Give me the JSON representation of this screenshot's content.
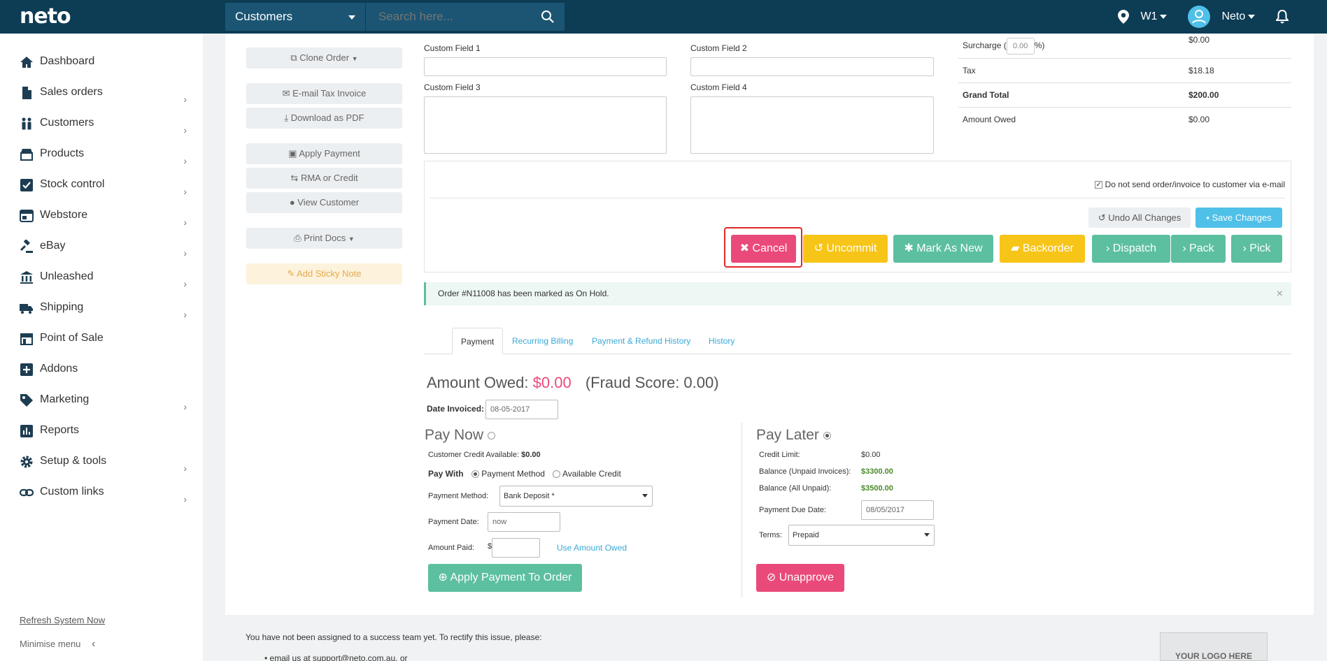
{
  "header": {
    "logo": "neto",
    "search_scope": "Customers",
    "search_placeholder": "Search here...",
    "location": "W1",
    "user": "Neto"
  },
  "sidebar": {
    "items": [
      {
        "label": "Dashboard",
        "icon": "home-icon",
        "has_children": false
      },
      {
        "label": "Sales orders",
        "icon": "document-icon",
        "has_children": true
      },
      {
        "label": "Customers",
        "icon": "people-icon",
        "has_children": true
      },
      {
        "label": "Products",
        "icon": "shop-icon",
        "has_children": true
      },
      {
        "label": "Stock control",
        "icon": "checkbox-icon",
        "has_children": true
      },
      {
        "label": "Webstore",
        "icon": "browser-icon",
        "has_children": true
      },
      {
        "label": "eBay",
        "icon": "gavel-icon",
        "has_children": true
      },
      {
        "label": "Unleashed",
        "icon": "bank-icon",
        "has_children": true
      },
      {
        "label": "Shipping",
        "icon": "truck-icon",
        "has_children": true
      },
      {
        "label": "Point of Sale",
        "icon": "store-icon",
        "has_children": false
      },
      {
        "label": "Addons",
        "icon": "plus-square-icon",
        "has_children": false
      },
      {
        "label": "Marketing",
        "icon": "tag-icon",
        "has_children": true
      },
      {
        "label": "Reports",
        "icon": "chart-icon",
        "has_children": false
      },
      {
        "label": "Setup & tools",
        "icon": "gear-icon",
        "has_children": true
      },
      {
        "label": "Custom links",
        "icon": "link-icon",
        "has_children": true
      }
    ],
    "refresh": "Refresh System Now",
    "minimise": "Minimise menu"
  },
  "left_actions": {
    "clone": "Clone Order",
    "email": "E-mail Tax Invoice",
    "pdf": "Download as PDF",
    "apply_payment": "Apply Payment",
    "rma": "RMA or Credit",
    "view_customer": "View Customer",
    "print": "Print Docs",
    "sticky": "Add Sticky Note"
  },
  "custom_fields": {
    "f1": "Custom Field 1",
    "f2": "Custom Field 2",
    "f3": "Custom Field 3",
    "f4": "Custom Field 4"
  },
  "summary": {
    "surcharge_label": "Surcharge (",
    "surcharge_pct": "0.00",
    "surcharge_suffix": "%)",
    "surcharge_value": "$0.00",
    "tax_label": "Tax",
    "tax_value": "$18.18",
    "grand_label": "Grand Total",
    "grand_value": "$200.00",
    "owed_label": "Amount Owed",
    "owed_value": "$0.00"
  },
  "order_actions": {
    "no_email": "Do not send order/invoice to customer via e-mail",
    "undo": "Undo All Changes",
    "save": "Save Changes",
    "cancel": "Cancel",
    "uncommit": "Uncommit",
    "mark_new": "Mark As New",
    "backorder": "Backorder",
    "dispatch": "Dispatch",
    "pack": "Pack",
    "pick": "Pick"
  },
  "alert": {
    "message": "Order #N11008 has been marked as On Hold.",
    "close": "×"
  },
  "tabs": [
    "Payment",
    "Recurring Billing",
    "Payment & Refund History",
    "History"
  ],
  "payment": {
    "owed_label": "Amount Owed:",
    "owed_value": "$0.00",
    "fraud": "(Fraud Score: 0.00)",
    "date_invoiced_label": "Date Invoiced:",
    "date_invoiced": "08-05-2017",
    "pay_now": "Pay Now",
    "credit_label": "Customer Credit Available:",
    "credit_value": "$0.00",
    "pay_with": "Pay With",
    "opt_method": "Payment Method",
    "opt_credit": "Available Credit",
    "method_label": "Payment Method:",
    "method_value": "Bank Deposit *",
    "date_label": "Payment Date:",
    "date_value": "now",
    "amount_label": "Amount Paid:",
    "currency": "$",
    "use_owed": "Use Amount Owed",
    "apply_btn": "Apply Payment To Order",
    "pay_later": "Pay Later",
    "credit_limit_label": "Credit Limit:",
    "credit_limit": "$0.00",
    "bal_unpaid_label": "Balance (Unpaid Invoices):",
    "bal_unpaid": "$3300.00",
    "bal_all_label": "Balance (All Unpaid):",
    "bal_all": "$3500.00",
    "due_label": "Payment Due Date:",
    "due_value": "08/05/2017",
    "terms_label": "Terms:",
    "terms_value": "Prepaid",
    "unapprove": "Unapprove"
  },
  "footer": {
    "text": "You have not been assigned to a success team yet. To rectify this issue, please:",
    "bullet": "email us at support@neto.com.au, or",
    "logo_box": "YOUR LOGO HERE"
  }
}
